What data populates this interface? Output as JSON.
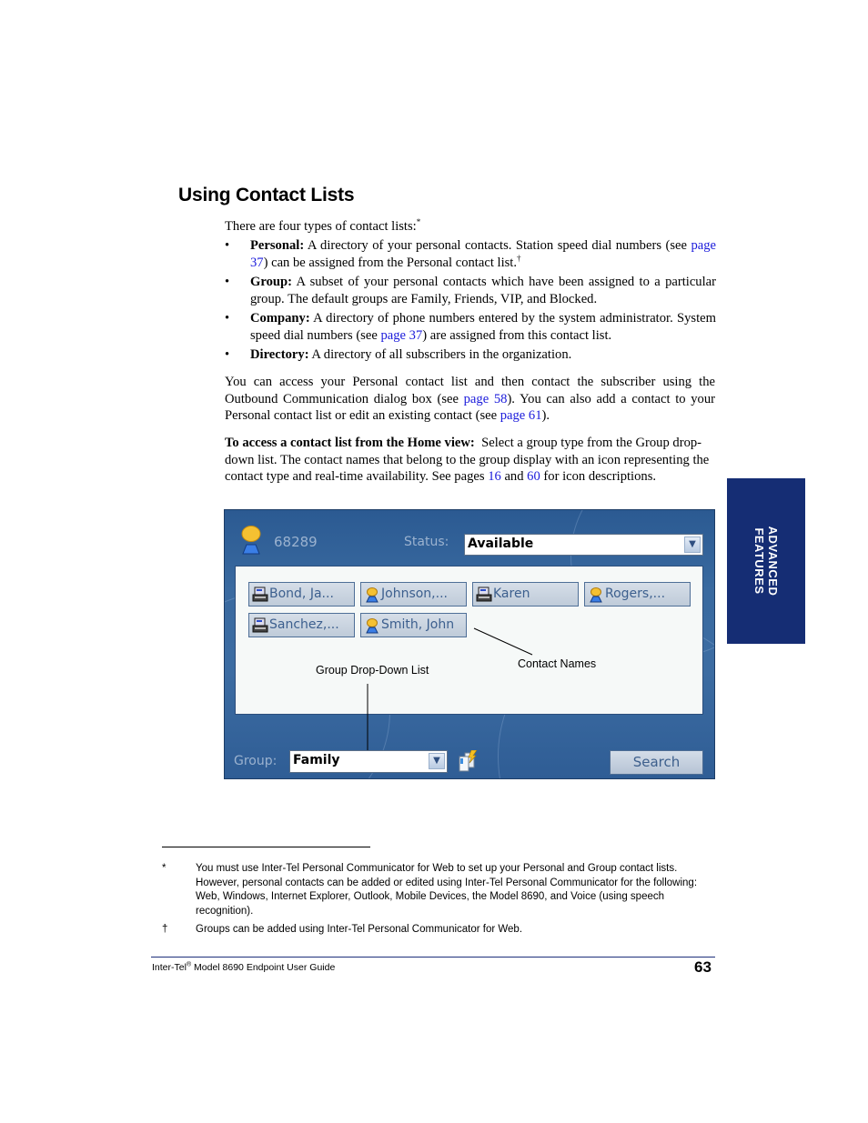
{
  "heading": "Using Contact Lists",
  "intro": {
    "text": "There are four types of contact lists:",
    "footnote_mark": "*"
  },
  "types": [
    {
      "term": "Personal:",
      "text_before_link": " A directory of your personal contacts. Station speed dial numbers (see ",
      "link": "page 37",
      "text_after_link": ") can be assigned from the Personal contact list.",
      "footnote_mark": "†"
    },
    {
      "term": "Group:",
      "text_before_link": " A subset of your personal contacts which have been assigned to a particular group. The default groups are Family, Friends, VIP, and Blocked.",
      "link": "",
      "text_after_link": "",
      "footnote_mark": ""
    },
    {
      "term": "Company:",
      "text_before_link": " A directory of phone numbers entered by the system administrator. System speed dial numbers (see ",
      "link": "page 37",
      "text_after_link": ") are assigned from this contact list.",
      "footnote_mark": ""
    },
    {
      "term": "Directory:",
      "text_before_link": " A directory of all subscribers in the organization.",
      "link": "",
      "text_after_link": "",
      "footnote_mark": ""
    }
  ],
  "para1": {
    "t1": "You can access your Personal contact list and then contact the subscriber using the Outbound Communication dialog box (see ",
    "link1": "page 58",
    "t2": "). You can also add a contact to your Personal contact list or edit an existing contact (see ",
    "link2": "page 61",
    "t3": ")."
  },
  "para2": {
    "bold": "To access a contact list from the Home view:",
    "t1": "  Select a group type from the Group drop-down list. The contact names that belong to the group display with an icon representing the contact type and real-time availability. See pages ",
    "link1": "16",
    "t2": " and ",
    "link2": "60",
    "t3": " for icon descriptions."
  },
  "screen": {
    "extension": "68289",
    "status_label": "Status:",
    "status_value": "Available",
    "contacts": [
      {
        "name": "Bond, Ja...",
        "icon": "phone-icon"
      },
      {
        "name": "Johnson,...",
        "icon": "person-icon"
      },
      {
        "name": "Karen",
        "icon": "phone-icon"
      },
      {
        "name": "Rogers,...",
        "icon": "person-icon"
      },
      {
        "name": "Sanchez,...",
        "icon": "phone-icon"
      },
      {
        "name": "Smith, John",
        "icon": "person-icon"
      }
    ],
    "callout_group": "Group Drop-Down List",
    "callout_contacts": "Contact Names",
    "group_label": "Group:",
    "group_value": "Family",
    "search_label": "Search"
  },
  "side_tab": {
    "line1": "ADVANCED",
    "line2": "FEATURES"
  },
  "footnotes": [
    {
      "mark": "*",
      "text": "You must use Inter-Tel Personal Communicator for Web to set up your Personal and Group contact lists. However, personal contacts can be added or edited using Inter-Tel Personal Communicator for the following: Web, Windows, Internet Explorer, Outlook, Mobile Devices, the Model 8690, and Voice (using speech recognition)."
    },
    {
      "mark": "†",
      "text": "Groups can be added using Inter-Tel Personal Communicator for Web."
    }
  ],
  "footer": {
    "brand": "Inter-Tel",
    "reg": "®",
    "title": " Model 8690 Endpoint User Guide",
    "page_number": "63"
  },
  "colors": {
    "link": "#1a1adb",
    "side_tab": "#152d74",
    "screen_bg": "#3a6aa0"
  }
}
